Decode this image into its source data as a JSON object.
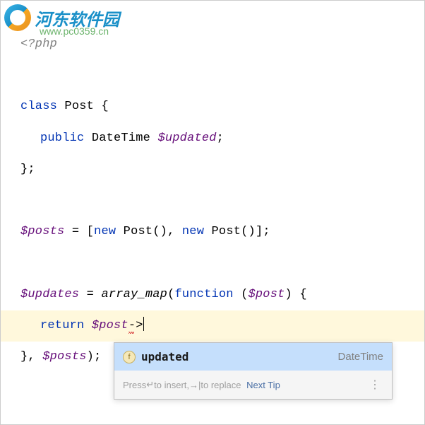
{
  "watermark": {
    "title": "河东软件园",
    "url": "www.pc0359.cn"
  },
  "code": {
    "php_open": "<?php",
    "class_kw": "class",
    "class_name": "Post",
    "public_kw": "public",
    "type_datetime": "DateTime",
    "var_updated": "$updated",
    "var_posts": "$posts",
    "new_kw": "new",
    "post_ctor": "Post",
    "var_updates": "$updates",
    "array_map": "array_map",
    "function_kw": "function",
    "var_post": "$post",
    "return_kw": "return",
    "arrow": "->"
  },
  "autocomplete": {
    "icon_letter": "f",
    "item_name": "updated",
    "item_type": "DateTime",
    "hint_prefix": "Press ",
    "hint_insert": " to insert, ",
    "hint_replace": " to replace",
    "next_tip": "Next Tip",
    "enter_glyph": "↵",
    "tab_glyph": "→|",
    "menu_dots": "⋮"
  },
  "chart_data": null
}
